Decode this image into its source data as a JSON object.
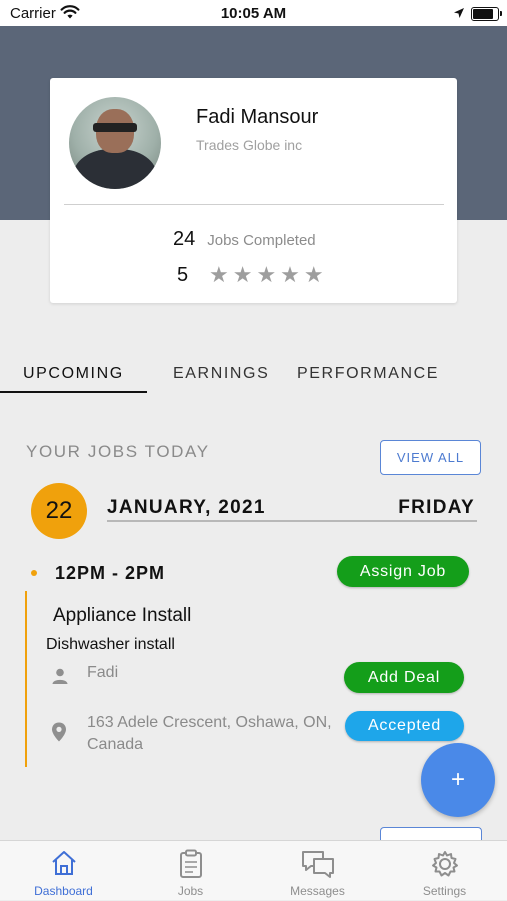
{
  "status_bar": {
    "carrier": "Carrier",
    "time": "10:05 AM",
    "battery_level": 0.9
  },
  "profile": {
    "name": "Fadi Mansour",
    "company": "Trades Globe inc",
    "jobs_completed_count": "24",
    "jobs_completed_label": "Jobs Completed",
    "rating_value": "5",
    "stars": "★★★★★"
  },
  "tabs": [
    {
      "label": "UPCOMING",
      "active": true
    },
    {
      "label": "EARNINGS",
      "active": false
    },
    {
      "label": "PERFORMANCE",
      "active": false
    }
  ],
  "jobs_today": {
    "title": "YOUR JOBS TODAY",
    "view_all_label": "VIEW ALL",
    "day": "22",
    "month_year": "JANUARY, 2021",
    "weekday": "FRIDAY"
  },
  "job": {
    "time_range": "12PM - 2PM",
    "assign_label": "Assign Job",
    "title": "Appliance Install",
    "description": "Dishwasher install",
    "assignee": "Fadi",
    "add_deal_label": "Add Deal",
    "address": "163 Adele Crescent, Oshawa, ON, Canada",
    "status_label": "Accepted"
  },
  "fab": {
    "label": "+"
  },
  "tabbar": [
    {
      "label": "Dashboard",
      "icon": "home-icon",
      "active": true
    },
    {
      "label": "Jobs",
      "icon": "clipboard-icon",
      "active": false
    },
    {
      "label": "Messages",
      "icon": "chat-bubbles-icon",
      "active": false
    },
    {
      "label": "Settings",
      "icon": "gear-icon",
      "active": false
    }
  ],
  "colors": {
    "header_band": "#5b6678",
    "accent_orange": "#f0a10c",
    "button_green": "#149e1a",
    "button_blue": "#1ea6ea",
    "fab_blue": "#4a89e8",
    "active_tab_blue": "#3f6fd6"
  }
}
